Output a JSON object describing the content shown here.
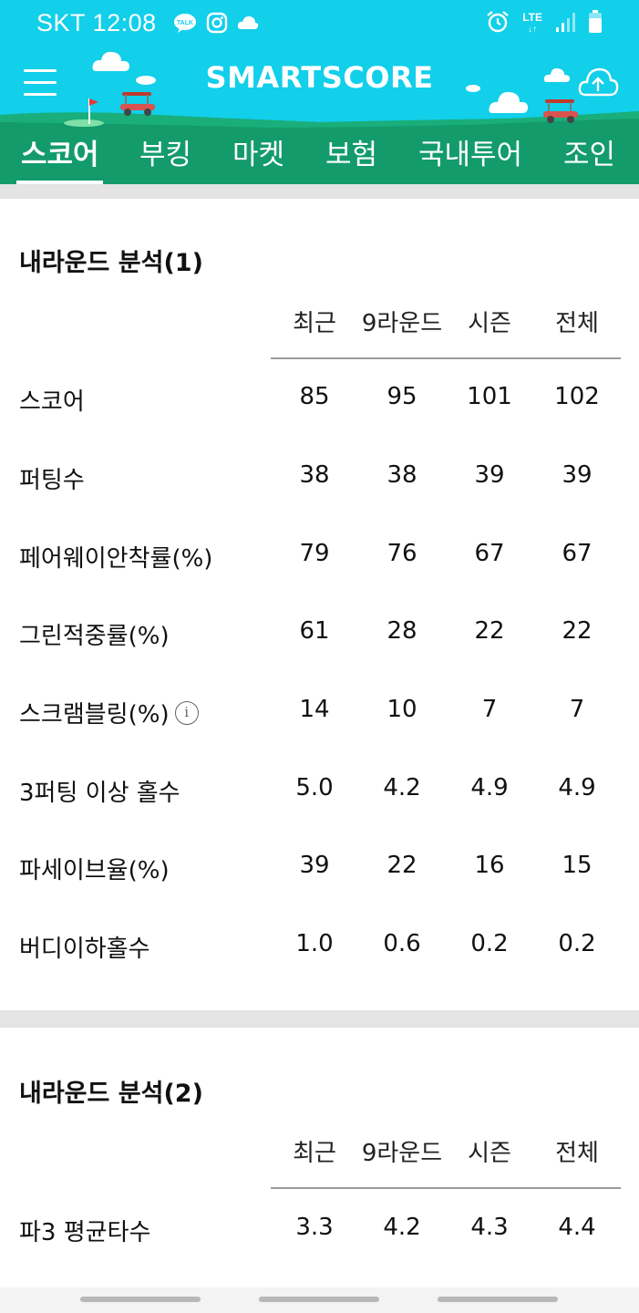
{
  "status_bar": {
    "carrier": "SKT",
    "time": "12:08",
    "kakao_badge": "TALK",
    "network": "LTE"
  },
  "app": {
    "title": "SMARTSCORE",
    "colors": {
      "header_bg": "#12cfea",
      "grass": "#139b6c",
      "active_tab_text": "#ffffff"
    }
  },
  "tabs": [
    {
      "label": "스코어",
      "active": true
    },
    {
      "label": "부킹",
      "active": false
    },
    {
      "label": "마켓",
      "active": false
    },
    {
      "label": "보험",
      "active": false
    },
    {
      "label": "국내투어",
      "active": false
    },
    {
      "label": "조인",
      "active": false
    }
  ],
  "analysis1": {
    "title": "내라운드 분석(1)",
    "columns": [
      "최근",
      "9라운드",
      "시즌",
      "전체"
    ],
    "rows": [
      {
        "label": "스코어",
        "values": [
          "85",
          "95",
          "101",
          "102"
        ]
      },
      {
        "label": "퍼팅수",
        "values": [
          "38",
          "38",
          "39",
          "39"
        ]
      },
      {
        "label": "페어웨이안착률(%)",
        "values": [
          "79",
          "76",
          "67",
          "67"
        ]
      },
      {
        "label": "그린적중률(%)",
        "values": [
          "61",
          "28",
          "22",
          "22"
        ]
      },
      {
        "label": "스크램블링(%)",
        "values": [
          "14",
          "10",
          "7",
          "7"
        ],
        "info": "i"
      },
      {
        "label": "3퍼팅 이상 홀수",
        "values": [
          "5.0",
          "4.2",
          "4.9",
          "4.9"
        ]
      },
      {
        "label": "파세이브율(%)",
        "values": [
          "39",
          "22",
          "16",
          "15"
        ]
      },
      {
        "label": "버디이하홀수",
        "values": [
          "1.0",
          "0.6",
          "0.2",
          "0.2"
        ]
      }
    ]
  },
  "analysis2": {
    "title": "내라운드 분석(2)",
    "columns": [
      "최근",
      "9라운드",
      "시즌",
      "전체"
    ],
    "rows": [
      {
        "label": "파3 평균타수",
        "values": [
          "3.3",
          "4.2",
          "4.3",
          "4.4"
        ]
      }
    ]
  }
}
